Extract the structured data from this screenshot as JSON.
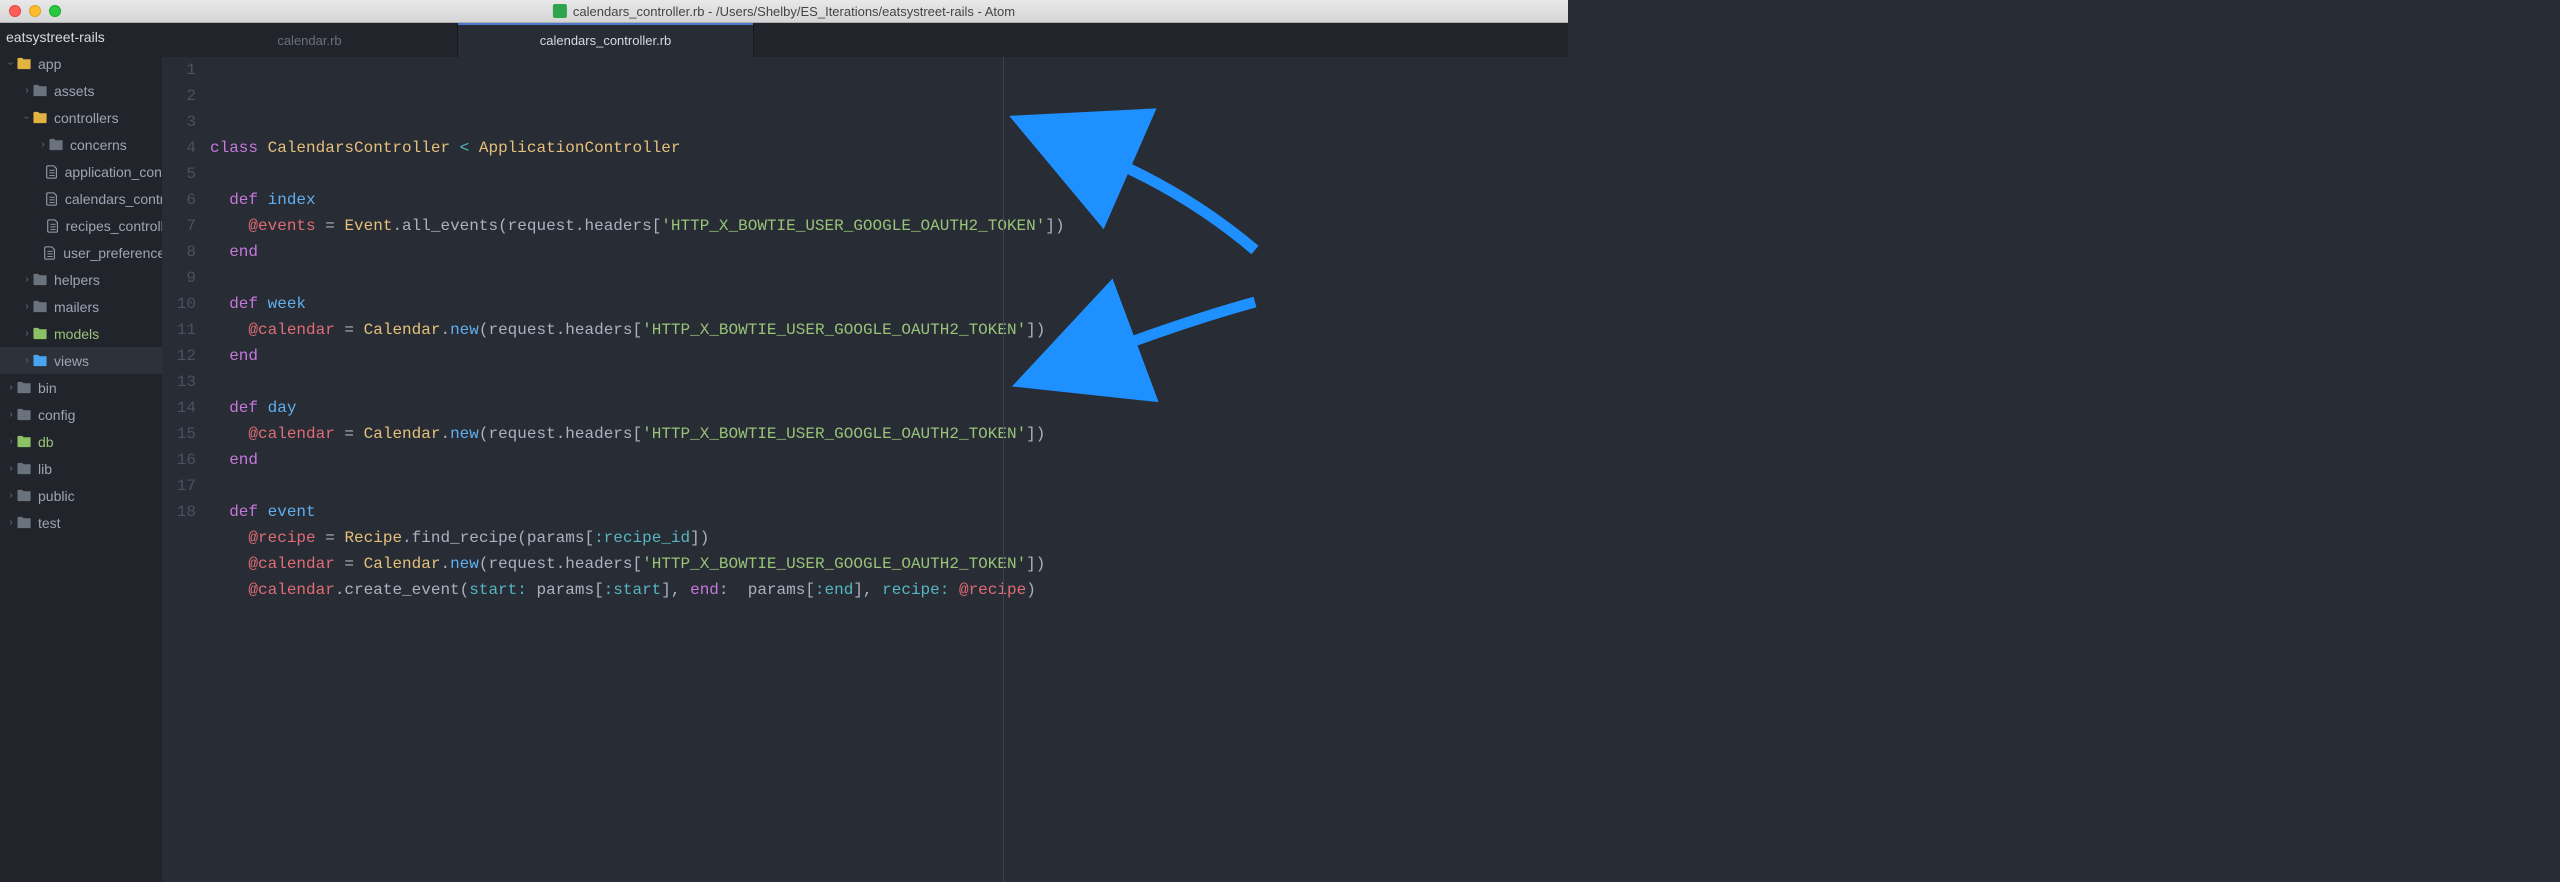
{
  "window": {
    "title": "calendars_controller.rb - /Users/Shelby/ES_Iterations/eatsystreet-rails - Atom"
  },
  "sidebar": {
    "project": "eatsystreet-rails",
    "items": [
      {
        "label": "app",
        "type": "folder-open",
        "indent": 0,
        "chevron": "down"
      },
      {
        "label": "assets",
        "type": "folder-default",
        "indent": 1,
        "chevron": "right"
      },
      {
        "label": "controllers",
        "type": "folder-open",
        "indent": 1,
        "chevron": "down"
      },
      {
        "label": "concerns",
        "type": "folder-default",
        "indent": 2,
        "chevron": "right"
      },
      {
        "label": "application_controller.rb",
        "type": "file",
        "indent": 2,
        "chevron": ""
      },
      {
        "label": "calendars_controller.rb",
        "type": "file",
        "indent": 2,
        "chevron": ""
      },
      {
        "label": "recipes_controller.rb",
        "type": "file",
        "indent": 2,
        "chevron": ""
      },
      {
        "label": "user_preferences_controller.rb",
        "type": "file",
        "indent": 2,
        "chevron": ""
      },
      {
        "label": "helpers",
        "type": "folder-default",
        "indent": 1,
        "chevron": "right"
      },
      {
        "label": "mailers",
        "type": "folder-default",
        "indent": 1,
        "chevron": "right"
      },
      {
        "label": "models",
        "type": "folder-green",
        "indent": 1,
        "chevron": "right",
        "textClass": "green-text"
      },
      {
        "label": "views",
        "type": "folder-blue",
        "indent": 1,
        "chevron": "right",
        "selected": true
      },
      {
        "label": "bin",
        "type": "folder-default",
        "indent": 0,
        "chevron": "right"
      },
      {
        "label": "config",
        "type": "folder-default",
        "indent": 0,
        "chevron": "right"
      },
      {
        "label": "db",
        "type": "folder-green",
        "indent": 0,
        "chevron": "right",
        "textClass": "green-text"
      },
      {
        "label": "lib",
        "type": "folder-default",
        "indent": 0,
        "chevron": "right"
      },
      {
        "label": "public",
        "type": "folder-default",
        "indent": 0,
        "chevron": "right"
      },
      {
        "label": "test",
        "type": "folder-default",
        "indent": 0,
        "chevron": "right"
      }
    ]
  },
  "tabs": [
    {
      "label": "calendar.rb",
      "active": false
    },
    {
      "label": "calendars_controller.rb",
      "active": true
    }
  ],
  "code": {
    "lines": [
      [
        {
          "t": "class ",
          "c": "keyword"
        },
        {
          "t": "CalendarsController",
          "c": "class"
        },
        {
          "t": " < ",
          "c": "op"
        },
        {
          "t": "ApplicationController",
          "c": "class"
        }
      ],
      [
        {
          "t": "",
          "c": "plain"
        }
      ],
      [
        {
          "t": "  ",
          "c": "plain"
        },
        {
          "t": "def ",
          "c": "keyword"
        },
        {
          "t": "index",
          "c": "def"
        }
      ],
      [
        {
          "t": "    ",
          "c": "plain"
        },
        {
          "t": "@events",
          "c": "var"
        },
        {
          "t": " = ",
          "c": "plain"
        },
        {
          "t": "Event",
          "c": "class"
        },
        {
          "t": ".all_events(request.headers[",
          "c": "plain"
        },
        {
          "t": "'HTTP_X_BOWTIE_USER_GOOGLE_OAUTH2_TOKEN'",
          "c": "string"
        },
        {
          "t": "])",
          "c": "plain"
        }
      ],
      [
        {
          "t": "  ",
          "c": "plain"
        },
        {
          "t": "end",
          "c": "keyword"
        }
      ],
      [
        {
          "t": "",
          "c": "plain"
        }
      ],
      [
        {
          "t": "  ",
          "c": "plain"
        },
        {
          "t": "def ",
          "c": "keyword"
        },
        {
          "t": "week",
          "c": "def"
        }
      ],
      [
        {
          "t": "    ",
          "c": "plain"
        },
        {
          "t": "@calendar",
          "c": "var"
        },
        {
          "t": " = ",
          "c": "plain"
        },
        {
          "t": "Calendar",
          "c": "class"
        },
        {
          "t": ".",
          "c": "plain"
        },
        {
          "t": "new",
          "c": "def"
        },
        {
          "t": "(request.headers[",
          "c": "plain"
        },
        {
          "t": "'HTTP_X_BOWTIE_USER_GOOGLE_OAUTH2_TOKEN'",
          "c": "string"
        },
        {
          "t": "])",
          "c": "plain"
        }
      ],
      [
        {
          "t": "  ",
          "c": "plain"
        },
        {
          "t": "end",
          "c": "keyword"
        }
      ],
      [
        {
          "t": "",
          "c": "plain"
        }
      ],
      [
        {
          "t": "  ",
          "c": "plain"
        },
        {
          "t": "def ",
          "c": "keyword"
        },
        {
          "t": "day",
          "c": "def"
        }
      ],
      [
        {
          "t": "    ",
          "c": "plain"
        },
        {
          "t": "@calendar",
          "c": "var"
        },
        {
          "t": " = ",
          "c": "plain"
        },
        {
          "t": "Calendar",
          "c": "class"
        },
        {
          "t": ".",
          "c": "plain"
        },
        {
          "t": "new",
          "c": "def"
        },
        {
          "t": "(request.headers[",
          "c": "plain"
        },
        {
          "t": "'HTTP_X_BOWTIE_USER_GOOGLE_OAUTH2_TOKEN'",
          "c": "string"
        },
        {
          "t": "])",
          "c": "plain"
        }
      ],
      [
        {
          "t": "  ",
          "c": "plain"
        },
        {
          "t": "end",
          "c": "keyword"
        }
      ],
      [
        {
          "t": "",
          "c": "plain"
        }
      ],
      [
        {
          "t": "  ",
          "c": "plain"
        },
        {
          "t": "def ",
          "c": "keyword"
        },
        {
          "t": "event",
          "c": "def"
        }
      ],
      [
        {
          "t": "    ",
          "c": "plain"
        },
        {
          "t": "@recipe",
          "c": "var"
        },
        {
          "t": " = ",
          "c": "plain"
        },
        {
          "t": "Recipe",
          "c": "class"
        },
        {
          "t": ".find_recipe(params[",
          "c": "plain"
        },
        {
          "t": ":recipe_id",
          "c": "symbol"
        },
        {
          "t": "])",
          "c": "plain"
        }
      ],
      [
        {
          "t": "    ",
          "c": "plain"
        },
        {
          "t": "@calendar",
          "c": "var"
        },
        {
          "t": " = ",
          "c": "plain"
        },
        {
          "t": "Calendar",
          "c": "class"
        },
        {
          "t": ".",
          "c": "plain"
        },
        {
          "t": "new",
          "c": "def"
        },
        {
          "t": "(request.headers[",
          "c": "plain"
        },
        {
          "t": "'HTTP_X_BOWTIE_USER_GOOGLE_OAUTH2_TOKEN'",
          "c": "string"
        },
        {
          "t": "])",
          "c": "plain"
        }
      ],
      [
        {
          "t": "    ",
          "c": "plain"
        },
        {
          "t": "@calendar",
          "c": "var"
        },
        {
          "t": ".create_event(",
          "c": "plain"
        },
        {
          "t": "start:",
          "c": "symbol"
        },
        {
          "t": " params[",
          "c": "plain"
        },
        {
          "t": ":start",
          "c": "symbol"
        },
        {
          "t": "], ",
          "c": "plain"
        },
        {
          "t": "end",
          "c": "keyword"
        },
        {
          "t": ": ",
          "c": "plain"
        },
        {
          "t": " params[",
          "c": "plain"
        },
        {
          "t": ":end",
          "c": "symbol"
        },
        {
          "t": "], ",
          "c": "plain"
        },
        {
          "t": "recipe:",
          "c": "symbol"
        },
        {
          "t": " ",
          "c": "plain"
        },
        {
          "t": "@recipe",
          "c": "var"
        },
        {
          "t": ")",
          "c": "plain"
        }
      ]
    ]
  }
}
